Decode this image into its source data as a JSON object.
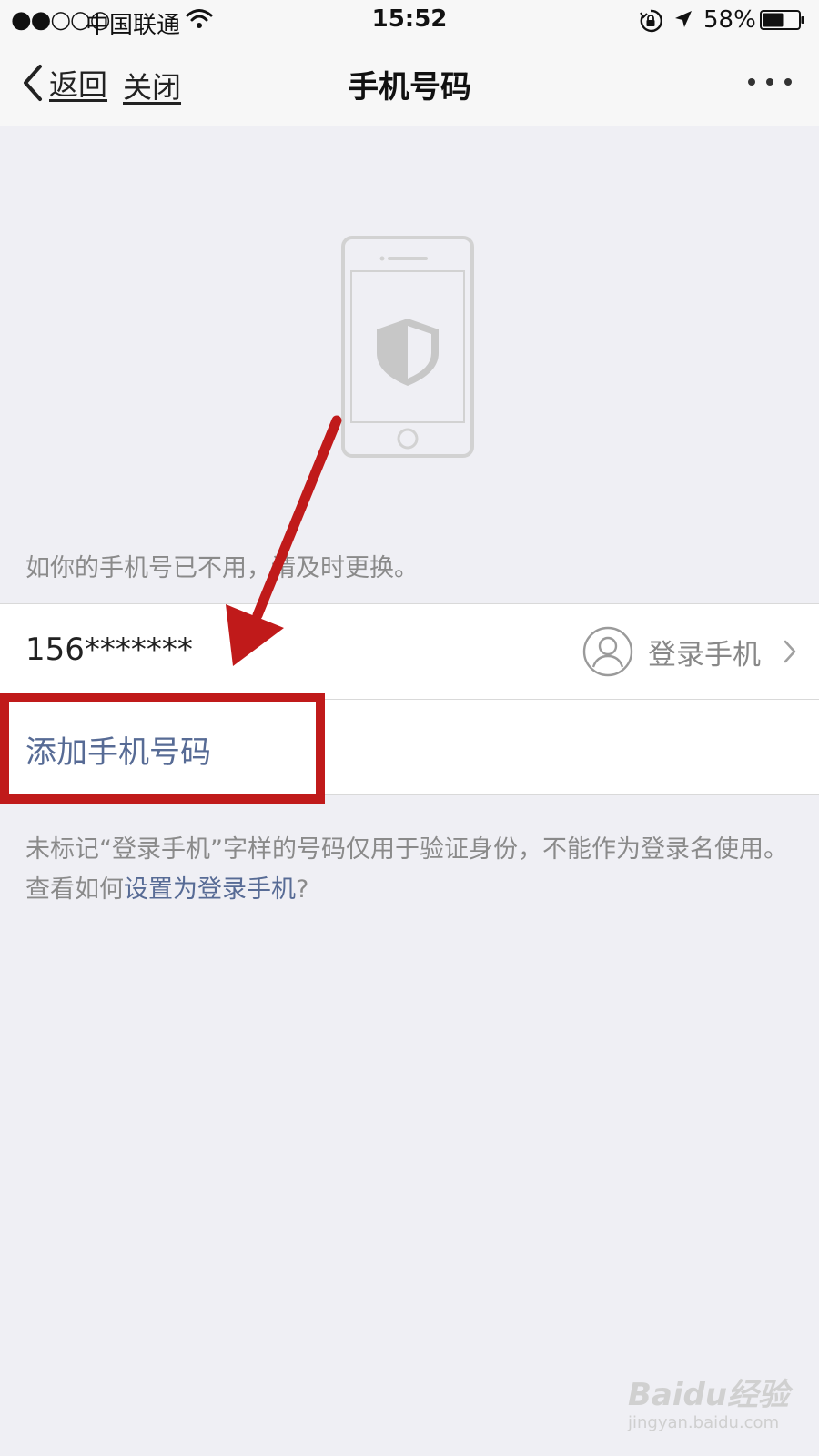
{
  "status_bar": {
    "signal": "●●○○○",
    "carrier": "中国联通",
    "time": "15:52",
    "battery_percent": "58%",
    "battery_level": 0.58,
    "icons": [
      "wifi-icon",
      "orientation-lock-icon",
      "location-icon",
      "battery-icon"
    ]
  },
  "nav": {
    "back_label": "返回",
    "close_label": "关闭",
    "title": "手机号码",
    "icons": [
      "chevron-left-icon",
      "more-icon"
    ]
  },
  "illustration": {
    "icon": "phone-shield-icon"
  },
  "hint": "如你的手机号已不用，请及时更换。",
  "phone_list": {
    "number": "156*******",
    "login_badge_label": "登录手机",
    "add_label": "添加手机号码",
    "icons": [
      "avatar-icon",
      "chevron-right-icon"
    ]
  },
  "note": {
    "text_before": "未标记“登录手机”字样的号码仅用于验证身份，不能作为登录名使用。查看如何",
    "link_text": "设置为登录手机",
    "text_after": "?"
  },
  "annotation": {
    "color": "#c01a1a",
    "shapes": [
      "arrow",
      "highlight-box"
    ]
  },
  "watermark": {
    "brand": "Baidu经验",
    "url": "jingyan.baidu.com"
  },
  "colors": {
    "background": "#efeff4",
    "link": "#576b95",
    "secondary_text": "#8a8a8a"
  }
}
